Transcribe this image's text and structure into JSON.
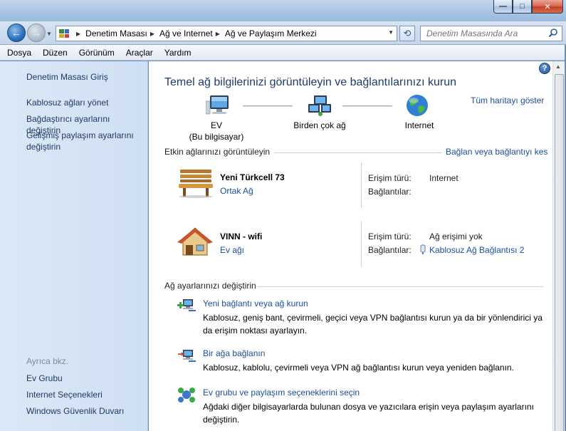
{
  "window": {
    "controls": {
      "minimize": "—",
      "maximize": "□",
      "close": "✕"
    }
  },
  "nav": {
    "breadcrumbs": [
      "Denetim Masası",
      "Ağ ve Internet",
      "Ağ ve Paylaşım Merkezi"
    ],
    "search_placeholder": "Denetim Masasında Ara"
  },
  "menu": [
    "Dosya",
    "Düzen",
    "Görünüm",
    "Araçlar",
    "Yardım"
  ],
  "sidebar": {
    "home": "Denetim Masası Giriş",
    "tasks": [
      "Kablosuz ağları yönet",
      "Bağdaştırıcı ayarlarını değiştirin",
      "Gelişmiş paylaşım ayarlarını değiştirin"
    ],
    "see_also_label": "Ayrıca bkz.",
    "see_also": [
      "Ev Grubu",
      "Internet Seçenekleri",
      "Windows Güvenlik Duvarı"
    ]
  },
  "main": {
    "title": "Temel ağ bilgilerinizi görüntüleyin ve bağlantılarınızı kurun",
    "full_map": "Tüm haritayı göster",
    "map": {
      "pc": [
        "EV",
        "(Bu bilgisayar)"
      ],
      "multi": "Birden çok ağ",
      "internet": "Internet"
    },
    "active_head": "Etkin ağlarınızı görüntüleyin",
    "connect_link": "Bağlan veya bağlantıyı kes",
    "networks": [
      {
        "name": "Yeni Türkcell  73",
        "type": "Ortak Ağ",
        "access_label": "Erişim türü:",
        "access_value": "Internet",
        "conn_label": "Bağlantılar:",
        "conn_value": ""
      },
      {
        "name": "VINN - wifi",
        "type": "Ev ağı",
        "access_label": "Erişim türü:",
        "access_value": "Ağ erişimi yok",
        "conn_label": "Bağlantılar:",
        "conn_value": "Kablosuz Ağ Bağlantısı 2"
      }
    ],
    "settings_head": "Ağ ayarlarınızı değiştirin",
    "tasks": [
      {
        "link": "Yeni bağlantı veya ağ kurun",
        "desc": "Kablosuz, geniş bant, çevirmeli, geçici veya VPN bağlantısı kurun ya da bir yönlendirici ya da erişim noktası ayarlayın."
      },
      {
        "link": "Bir ağa bağlanın",
        "desc": "Kablosuz, kablolu, çevirmeli veya VPN ağ bağlantısı kurun veya yeniden bağlanın."
      },
      {
        "link": "Ev grubu ve paylaşım seçeneklerini seçin",
        "desc": "Ağdaki diğer bilgisayarlarda bulunan dosya ve yazıcılara erişin veya paylaşım ayarlarını değiştirin."
      }
    ]
  }
}
